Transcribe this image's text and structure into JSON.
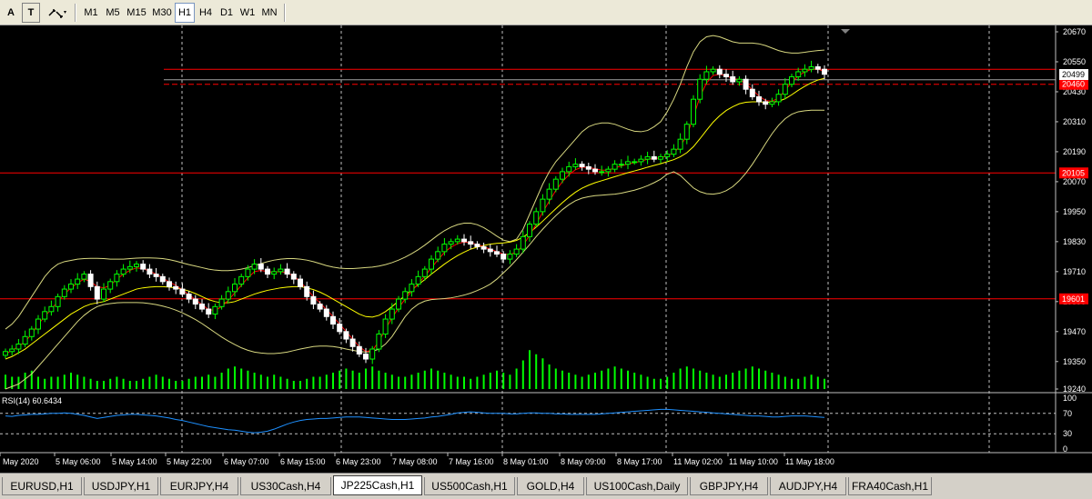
{
  "toolbar": {
    "text_tool": "A",
    "text_label_tool": "T",
    "timeframes": [
      "M1",
      "M5",
      "M15",
      "M30",
      "H1",
      "H4",
      "D1",
      "W1",
      "MN"
    ],
    "active_timeframe": "H1"
  },
  "chart": {
    "price_labels": [
      "20670",
      "20550",
      "20430",
      "20310",
      "20190",
      "20070",
      "19950",
      "19830",
      "19710",
      "19590",
      "19470",
      "19350",
      "19240"
    ],
    "price_label_values": [
      20670,
      20550,
      20430,
      20310,
      20190,
      20070,
      19950,
      19830,
      19710,
      19590,
      19470,
      19350,
      19240
    ],
    "current_price": "20499",
    "current_price_value": 20499,
    "level_labels": [
      {
        "text": "20460",
        "value": 20460
      },
      {
        "text": "20105",
        "value": 20105
      },
      {
        "text": "19601",
        "value": 19601
      }
    ],
    "horizontal_lines": [
      20520,
      20460,
      20105,
      19601
    ],
    "time_labels": [
      "May 2020",
      "5 May 06:00",
      "5 May 14:00",
      "5 May 22:00",
      "6 May 07:00",
      "6 May 15:00",
      "6 May 23:00",
      "7 May 08:00",
      "7 May 16:00",
      "8 May 01:00",
      "8 May 09:00",
      "8 May 17:00",
      "11 May 02:00",
      "11 May 10:00",
      "11 May 18:00"
    ],
    "rsi_label": "RSI(14) 60.6434",
    "rsi_levels": [
      "100",
      "70",
      "30",
      "0"
    ],
    "colors": {
      "bull": "#00ff00",
      "bear": "#ffffff",
      "ma_fast": "#ff0000",
      "ma_slow": "#ffff00",
      "bands": "#d8d880",
      "rsi": "#1e90ff",
      "level": "#ff0000",
      "price_box": "#ffffff",
      "level_box": "#ff0000"
    }
  },
  "chart_data": {
    "type": "candlestick",
    "symbol": "JP225Cash",
    "timeframe": "H1",
    "ylim": [
      19240,
      20700
    ],
    "close": [
      19390,
      19400,
      19420,
      19450,
      19480,
      19520,
      19550,
      19570,
      19610,
      19640,
      19660,
      19680,
      19700,
      19650,
      19600,
      19640,
      19670,
      19700,
      19720,
      19730,
      19740,
      19720,
      19700,
      19690,
      19670,
      19650,
      19640,
      19620,
      19600,
      19580,
      19560,
      19540,
      19570,
      19600,
      19630,
      19660,
      19690,
      19720,
      19740,
      19720,
      19700,
      19710,
      19720,
      19700,
      19680,
      19650,
      19610,
      19580,
      19560,
      19530,
      19500,
      19470,
      19440,
      19410,
      19380,
      19360,
      19400,
      19460,
      19520,
      19560,
      19600,
      19630,
      19660,
      19690,
      19720,
      19760,
      19790,
      19820,
      19830,
      19840,
      19830,
      19820,
      19810,
      19800,
      19790,
      19780,
      19760,
      19780,
      19800,
      19850,
      19900,
      19950,
      20000,
      20040,
      20080,
      20110,
      20130,
      20140,
      20130,
      20120,
      20110,
      20110,
      20120,
      20140,
      20140,
      20150,
      20150,
      20160,
      20170,
      20160,
      20170,
      20180,
      20200,
      20240,
      20300,
      20400,
      20480,
      20510,
      20520,
      20500,
      20490,
      20470,
      20480,
      20440,
      20410,
      20390,
      20380,
      20390,
      20420,
      20460,
      20490,
      20510,
      20520,
      20530,
      20520,
      20500
    ],
    "ma_fast": [
      19380,
      19395,
      19410,
      19430,
      19460,
      19500,
      19530,
      19560,
      19590,
      19620,
      19645,
      19665,
      19680,
      19670,
      19650,
      19645,
      19655,
      19680,
      19700,
      19715,
      19725,
      19722,
      19712,
      19700,
      19685,
      19668,
      19655,
      19637,
      19618,
      19598,
      19578,
      19558,
      19555,
      19570,
      19595,
      19625,
      19655,
      19685,
      19710,
      19715,
      19710,
      19708,
      19710,
      19705,
      19692,
      19670,
      19640,
      19610,
      19585,
      19558,
      19530,
      19500,
      19470,
      19440,
      19410,
      19390,
      19395,
      19430,
      19480,
      19525,
      19565,
      19600,
      19632,
      19662,
      19692,
      19725,
      19757,
      19787,
      19808,
      19822,
      19828,
      19826,
      19818,
      19810,
      19800,
      19790,
      19780,
      19778,
      19788,
      19815,
      19855,
      19900,
      19948,
      19992,
      20035,
      20070,
      20098,
      20118,
      20128,
      20127,
      20122,
      20116,
      20116,
      20125,
      20133,
      20141,
      20146,
      20152,
      20160,
      20162,
      20166,
      20173,
      20186,
      20212,
      20255,
      20330,
      20410,
      20465,
      20495,
      20500,
      20495,
      20482,
      20480,
      20462,
      20438,
      20413,
      20395,
      20392,
      20405,
      20436,
      20468,
      20494,
      20509,
      20520,
      20521,
      20510
    ],
    "ma_slow": [
      19360,
      19370,
      19385,
      19400,
      19420,
      19440,
      19460,
      19480,
      19500,
      19520,
      19540,
      19555,
      19570,
      19580,
      19585,
      19590,
      19600,
      19610,
      19620,
      19630,
      19640,
      19645,
      19648,
      19650,
      19650,
      19648,
      19645,
      19640,
      19632,
      19622,
      19610,
      19598,
      19590,
      19585,
      19585,
      19590,
      19600,
      19610,
      19620,
      19628,
      19635,
      19640,
      19645,
      19648,
      19650,
      19650,
      19645,
      19638,
      19628,
      19615,
      19600,
      19585,
      19570,
      19555,
      19540,
      19530,
      19528,
      19535,
      19550,
      19570,
      19592,
      19615,
      19637,
      19658,
      19678,
      19700,
      19720,
      19740,
      19758,
      19774,
      19788,
      19800,
      19808,
      19815,
      19820,
      19823,
      19825,
      19828,
      19835,
      19848,
      19866,
      19888,
      19912,
      19937,
      19962,
      19986,
      20008,
      20028,
      20044,
      20056,
      20066,
      20074,
      20082,
      20090,
      20098,
      20106,
      20113,
      20120,
      20128,
      20135,
      20142,
      20150,
      20158,
      20170,
      20186,
      20210,
      20242,
      20276,
      20308,
      20334,
      20355,
      20370,
      20382,
      20388,
      20390,
      20390,
      20388,
      20388,
      20392,
      20402,
      20418,
      20436,
      20452,
      20466,
      20477,
      20484
    ],
    "bb_upper": [
      19480,
      19500,
      19530,
      19570,
      19610,
      19650,
      19690,
      19720,
      19740,
      19750,
      19755,
      19760,
      19762,
      19763,
      19763,
      19762,
      19760,
      19760,
      19760,
      19762,
      19764,
      19765,
      19765,
      19764,
      19762,
      19758,
      19752,
      19745,
      19738,
      19732,
      19726,
      19720,
      19716,
      19714,
      19714,
      19716,
      19720,
      19726,
      19734,
      19742,
      19750,
      19756,
      19760,
      19762,
      19762,
      19760,
      19756,
      19750,
      19742,
      19734,
      19728,
      19724,
      19722,
      19722,
      19724,
      19726,
      19728,
      19732,
      19738,
      19746,
      19756,
      19768,
      19782,
      19798,
      19816,
      19836,
      19856,
      19874,
      19888,
      19898,
      19904,
      19904,
      19898,
      19886,
      19870,
      19852,
      19836,
      19830,
      19840,
      19880,
      19940,
      20000,
      20060,
      20110,
      20150,
      20180,
      20210,
      20240,
      20270,
      20290,
      20300,
      20305,
      20305,
      20300,
      20290,
      20280,
      20272,
      20270,
      20275,
      20290,
      20310,
      20350,
      20400,
      20460,
      20530,
      20590,
      20630,
      20650,
      20655,
      20650,
      20640,
      20630,
      20625,
      20625,
      20625,
      20622,
      20615,
      20605,
      20595,
      20588,
      20585,
      20585,
      20588,
      20592,
      20595,
      20597
    ],
    "bb_lower": [
      19240,
      19250,
      19260,
      19280,
      19300,
      19330,
      19360,
      19390,
      19420,
      19450,
      19480,
      19510,
      19535,
      19555,
      19570,
      19578,
      19582,
      19585,
      19586,
      19586,
      19586,
      19585,
      19582,
      19578,
      19572,
      19565,
      19556,
      19545,
      19532,
      19518,
      19502,
      19484,
      19466,
      19448,
      19432,
      19418,
      19405,
      19395,
      19388,
      19384,
      19382,
      19382,
      19384,
      19388,
      19394,
      19400,
      19405,
      19410,
      19412,
      19412,
      19410,
      19406,
      19400,
      19395,
      19390,
      19388,
      19390,
      19400,
      19420,
      19450,
      19490,
      19530,
      19560,
      19580,
      19592,
      19598,
      19600,
      19602,
      19605,
      19610,
      19616,
      19624,
      19634,
      19646,
      19660,
      19680,
      19705,
      19730,
      19758,
      19788,
      19818,
      19850,
      19880,
      19908,
      19934,
      19958,
      19978,
      19994,
      20004,
      20010,
      20014,
      20016,
      20018,
      20020,
      20024,
      20030,
      20036,
      20044,
      20054,
      20066,
      20080,
      20100,
      20110,
      20095,
      20070,
      20045,
      20030,
      20022,
      20020,
      20024,
      20034,
      20050,
      20074,
      20104,
      20140,
      20180,
      20222,
      20262,
      20296,
      20322,
      20340,
      20350,
      20354,
      20356,
      20356,
      20356
    ],
    "rsi": [
      65,
      64,
      66,
      67,
      68,
      68,
      69,
      70,
      70,
      71,
      70,
      68,
      66,
      63,
      60,
      62,
      64,
      66,
      67,
      68,
      68,
      67,
      66,
      65,
      63,
      61,
      58,
      56,
      53,
      50,
      47,
      44,
      42,
      40,
      38,
      37,
      35,
      33,
      32,
      33,
      35,
      39,
      44,
      49,
      53,
      56,
      58,
      59,
      60,
      60,
      61,
      62,
      63,
      63,
      63,
      62,
      61,
      60,
      59,
      58,
      58,
      58,
      59,
      60,
      61,
      63,
      64,
      66,
      68,
      71,
      72,
      73,
      72,
      71,
      70,
      70,
      70,
      69,
      69,
      70,
      71,
      71,
      70,
      70,
      69,
      69,
      68,
      68,
      68,
      68,
      68,
      69,
      70,
      71,
      72,
      73,
      74,
      75,
      76,
      77,
      78,
      78,
      77,
      76,
      75,
      74,
      73,
      72,
      71,
      70,
      69,
      68,
      67,
      66,
      65,
      65,
      64,
      63,
      63,
      64,
      65,
      65,
      65,
      64,
      63,
      62
    ],
    "volume": [
      0.35,
      0.3,
      0.3,
      0.4,
      0.45,
      0.3,
      0.25,
      0.3,
      0.3,
      0.35,
      0.4,
      0.35,
      0.3,
      0.25,
      0.2,
      0.2,
      0.25,
      0.3,
      0.25,
      0.2,
      0.2,
      0.25,
      0.3,
      0.35,
      0.3,
      0.25,
      0.2,
      0.2,
      0.25,
      0.3,
      0.3,
      0.35,
      0.3,
      0.4,
      0.5,
      0.55,
      0.5,
      0.45,
      0.4,
      0.35,
      0.3,
      0.35,
      0.3,
      0.25,
      0.2,
      0.2,
      0.25,
      0.3,
      0.3,
      0.35,
      0.4,
      0.45,
      0.5,
      0.45,
      0.4,
      0.5,
      0.55,
      0.45,
      0.4,
      0.35,
      0.3,
      0.3,
      0.35,
      0.4,
      0.45,
      0.5,
      0.45,
      0.4,
      0.35,
      0.3,
      0.3,
      0.25,
      0.3,
      0.35,
      0.4,
      0.45,
      0.4,
      0.35,
      0.5,
      0.7,
      0.95,
      0.85,
      0.75,
      0.6,
      0.5,
      0.45,
      0.4,
      0.35,
      0.3,
      0.35,
      0.4,
      0.45,
      0.5,
      0.55,
      0.5,
      0.45,
      0.4,
      0.35,
      0.3,
      0.25,
      0.25,
      0.3,
      0.4,
      0.5,
      0.55,
      0.5,
      0.45,
      0.4,
      0.35,
      0.3,
      0.35,
      0.4,
      0.45,
      0.5,
      0.55,
      0.5,
      0.45,
      0.4,
      0.35,
      0.3,
      0.25,
      0.25,
      0.3,
      0.35,
      0.3,
      0.25
    ]
  },
  "tabs": [
    {
      "label": "EURUSD,H1",
      "active": false
    },
    {
      "label": "USDJPY,H1",
      "active": false
    },
    {
      "label": "EURJPY,H4",
      "active": false
    },
    {
      "label": "US30Cash,H4",
      "active": false
    },
    {
      "label": "JP225Cash,H1",
      "active": true
    },
    {
      "label": "US500Cash,H1",
      "active": false
    },
    {
      "label": "GOLD,H4",
      "active": false
    },
    {
      "label": "US100Cash,Daily",
      "active": false
    },
    {
      "label": "GBPJPY,H4",
      "active": false
    },
    {
      "label": "AUDJPY,H4",
      "active": false
    },
    {
      "label": "FRA40Cash,H1",
      "active": false
    }
  ]
}
